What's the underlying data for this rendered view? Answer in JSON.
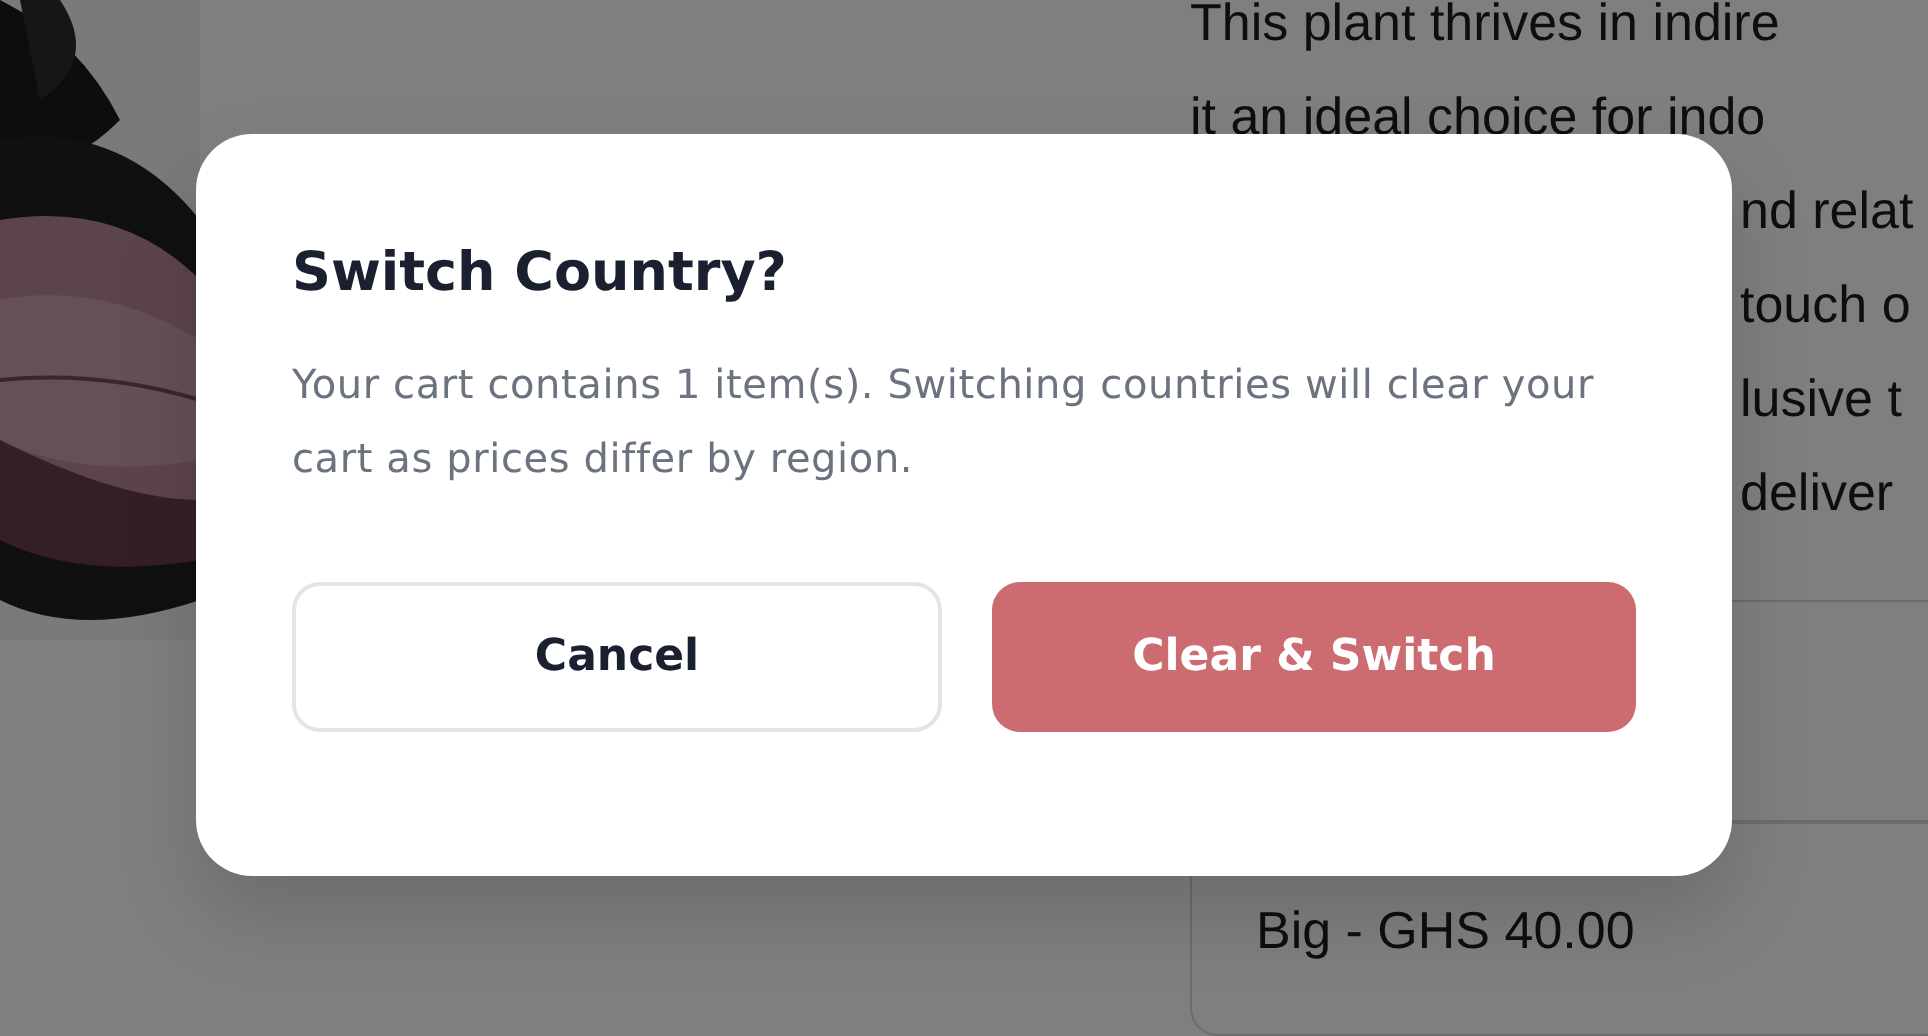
{
  "page": {
    "description_lines": [
      "This plant thrives in indire",
      "it an ideal choice for indo",
      "nd relat",
      "touch o",
      "lusive t",
      "deliver"
    ],
    "size_options": [
      {
        "label": "Big - GHS 40.00"
      }
    ]
  },
  "dialog": {
    "title": "Switch Country?",
    "message": "Your cart contains 1 item(s). Switching countries will clear your cart as prices differ by region.",
    "buttons": [
      {
        "label": "Cancel",
        "kind": "secondary"
      },
      {
        "label": "Clear & Switch",
        "kind": "primary"
      }
    ]
  }
}
